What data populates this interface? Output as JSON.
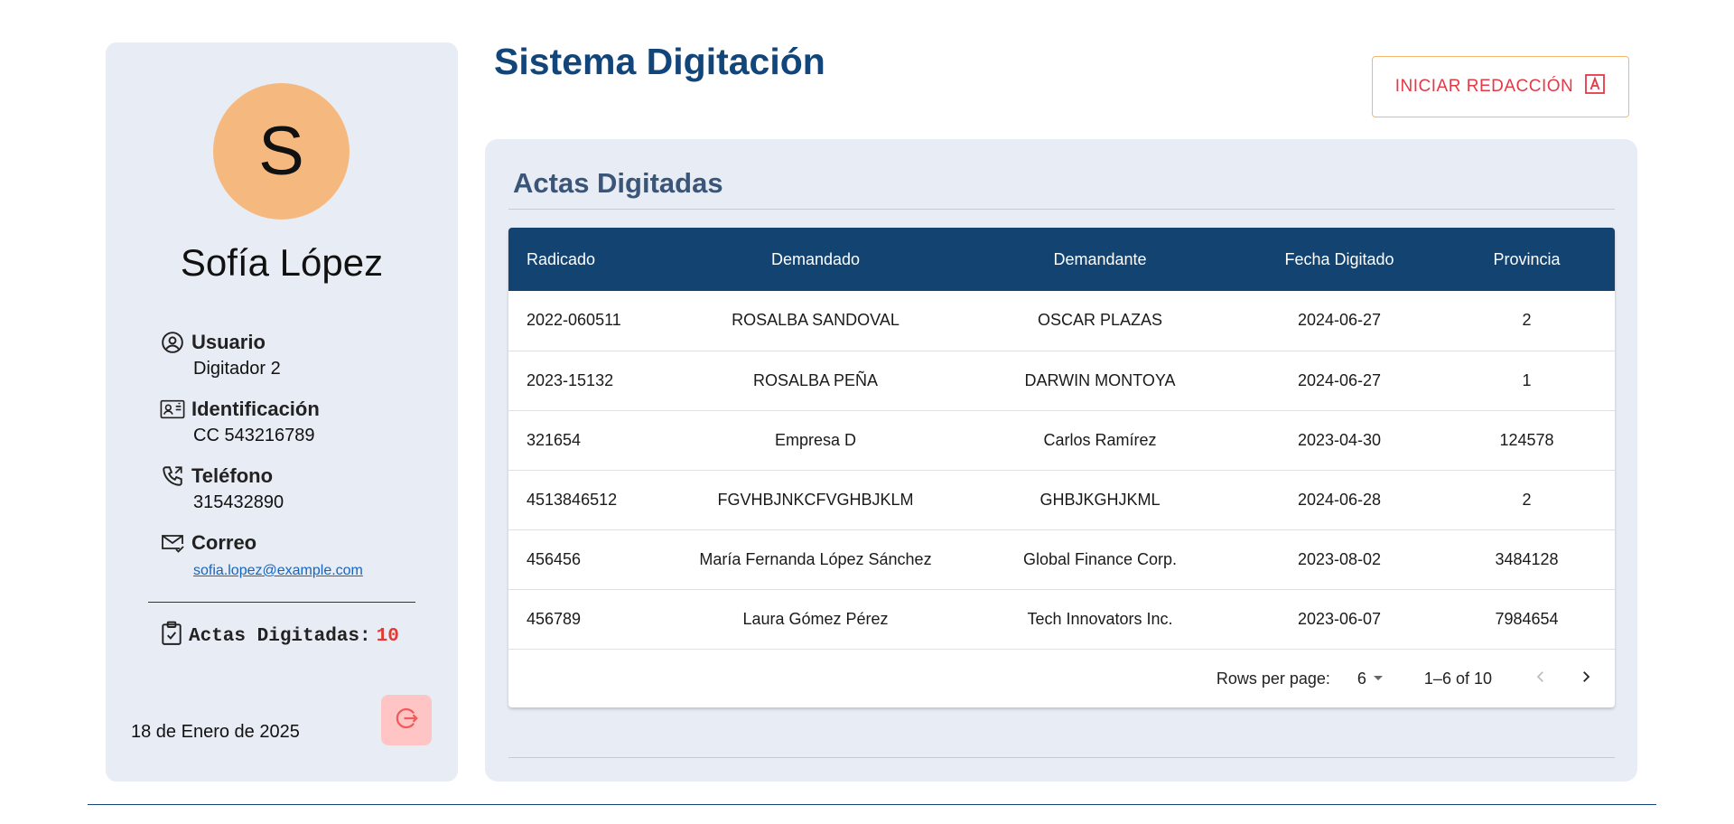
{
  "profile": {
    "avatar_letter": "S",
    "name": "Sofía López",
    "fields": [
      {
        "label": "Usuario",
        "value": "Digitador 2",
        "icon": "user-circle-icon"
      },
      {
        "label": "Identificación",
        "value": "CC 543216789",
        "icon": "id-card-icon"
      },
      {
        "label": "Teléfono",
        "value": "315432890",
        "icon": "phone-icon"
      },
      {
        "label": "Correo",
        "value": "sofia.lopez@example.com",
        "icon": "mail-icon"
      }
    ],
    "actas_label": "Actas Digitadas:",
    "actas_count": "10",
    "date": "18 de Enero de 2025"
  },
  "header": {
    "title": "Sistema Digitación",
    "start_button": "INICIAR REDACCIÓN"
  },
  "panel": {
    "title": "Actas Digitadas",
    "columns": [
      "Radicado",
      "Demandado",
      "Demandante",
      "Fecha Digitado",
      "Provincia"
    ],
    "rows": [
      [
        "2022-060511",
        "ROSALBA SANDOVAL",
        "OSCAR PLAZAS",
        "2024-06-27",
        "2"
      ],
      [
        "2023-15132",
        "ROSALBA PEÑA",
        "DARWIN MONTOYA",
        "2024-06-27",
        "1"
      ],
      [
        "321654",
        "Empresa D",
        "Carlos Ramírez",
        "2023-04-30",
        "124578"
      ],
      [
        "4513846512",
        "FGVHBJNKCFVGHBJKLM",
        "GHBJKGHJKML",
        "2024-06-28",
        "2"
      ],
      [
        "456456",
        "María Fernanda López Sánchez",
        "Global Finance Corp.",
        "2023-08-02",
        "3484128"
      ],
      [
        "456789",
        "Laura Gómez Pérez",
        "Tech Innovators Inc.",
        "2023-06-07",
        "7984654"
      ]
    ],
    "pagination": {
      "rows_per_page_label": "Rows per page:",
      "rows_per_page_value": "6",
      "range": "1–6 of 10"
    }
  },
  "colors": {
    "primary": "#12467a",
    "accent": "#e53945",
    "avatar": "#f5b97f",
    "panel_bg": "#e8ecf4"
  }
}
